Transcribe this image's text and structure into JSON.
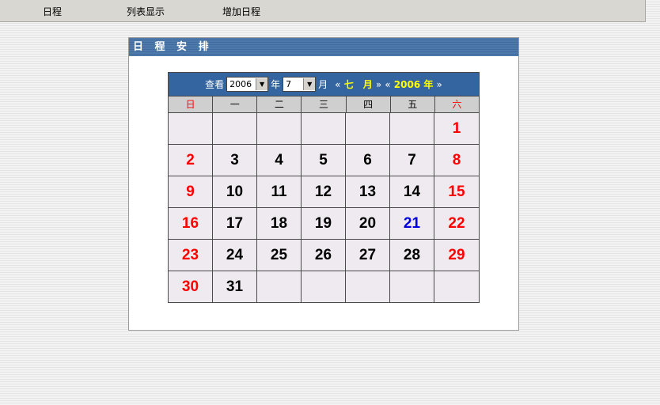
{
  "nav": {
    "items": [
      "日程",
      "列表显示",
      "增加日程"
    ]
  },
  "panel": {
    "title": "日 程 安 排"
  },
  "calendar": {
    "view_label": "查看",
    "year_value": "2006",
    "year_label": "年",
    "month_value": "7",
    "month_label": "月",
    "prev_mark": "«",
    "next_mark": "»",
    "month_nav_text": "七　月",
    "year_nav_text": "2006 年",
    "weekdays": [
      "日",
      "一",
      "二",
      "三",
      "四",
      "五",
      "六"
    ],
    "cells": [
      "",
      "",
      "",
      "",
      "",
      "",
      "1",
      "2",
      "3",
      "4",
      "5",
      "6",
      "7",
      "8",
      "9",
      "10",
      "11",
      "12",
      "13",
      "14",
      "15",
      "16",
      "17",
      "18",
      "19",
      "20",
      "21",
      "22",
      "23",
      "24",
      "25",
      "26",
      "27",
      "28",
      "29",
      "30",
      "31",
      "",
      "",
      "",
      "",
      ""
    ],
    "today": "21",
    "colors": {
      "weekend": "#ff0000",
      "today": "#0000dd",
      "weekday": "#000000",
      "header_bg": "#3465a0",
      "nav_link": "#ffff00"
    }
  }
}
